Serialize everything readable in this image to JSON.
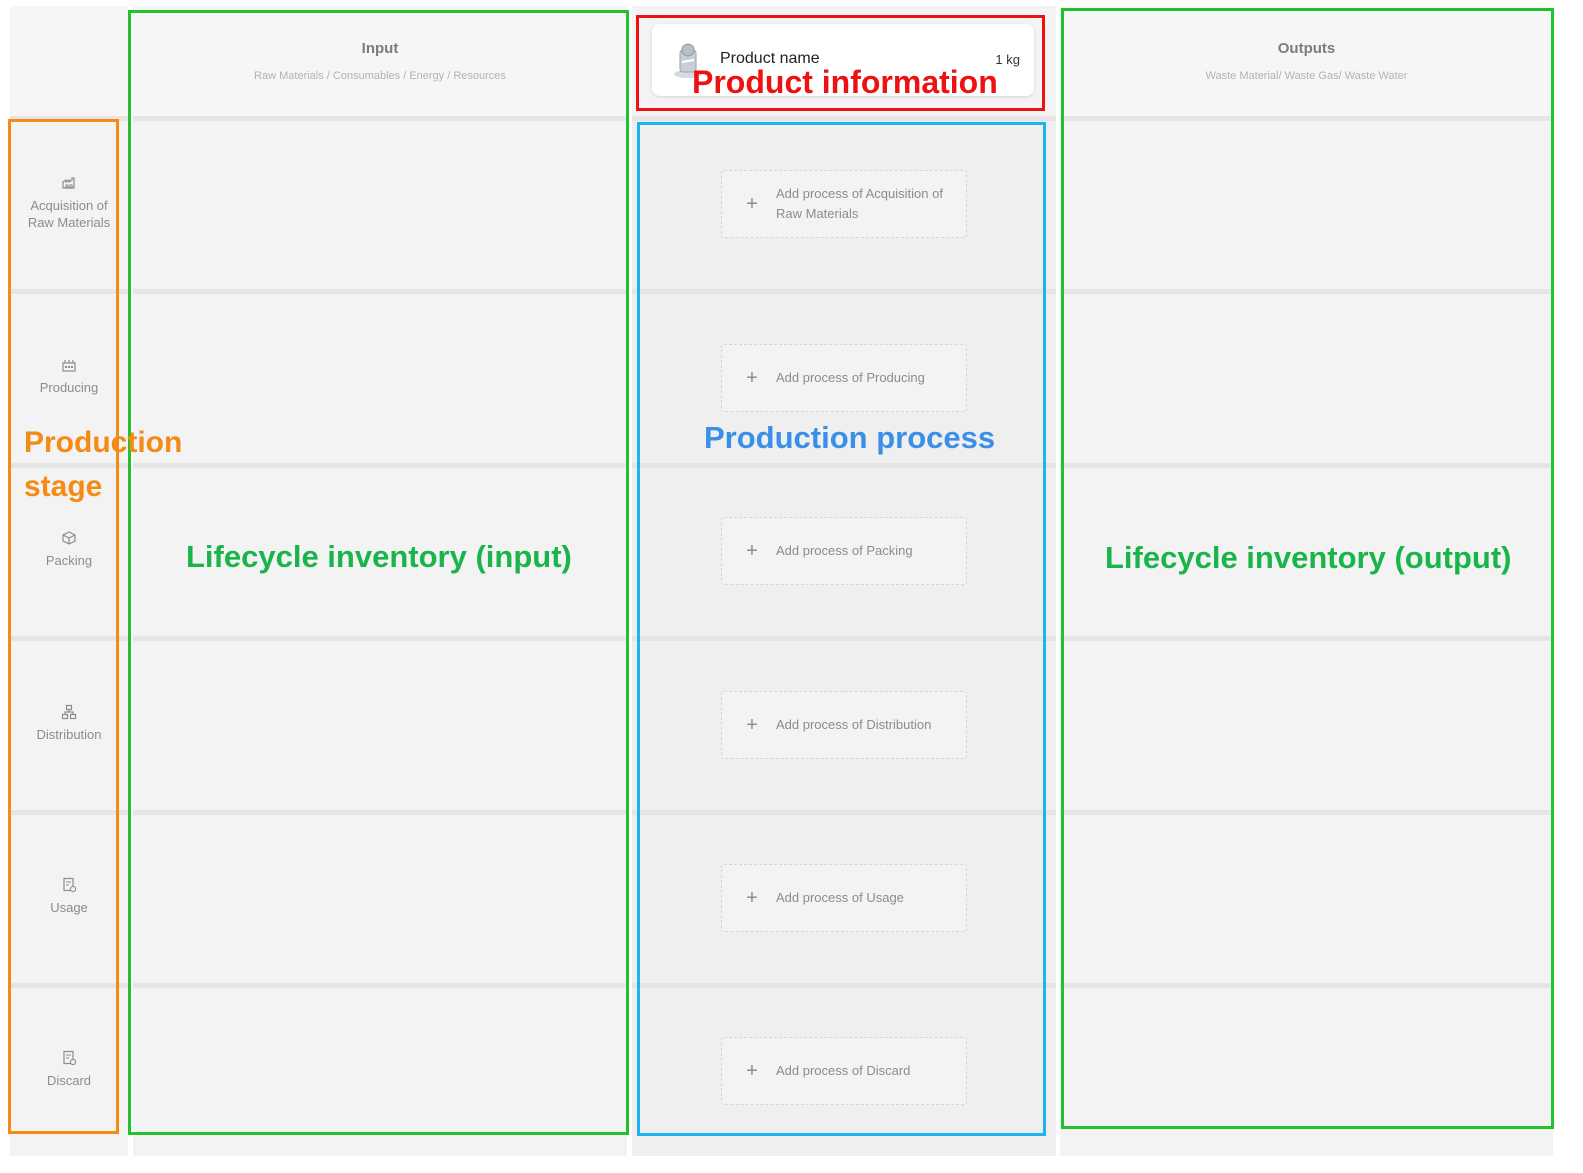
{
  "header": {
    "input_title": "Input",
    "input_subtitle": "Raw Materials / Consumables / Energy / Resources",
    "output_title": "Outputs",
    "output_subtitle": "Waste Material/ Waste Gas/ Waste Water"
  },
  "product": {
    "name": "Product name",
    "quantity": "1 kg"
  },
  "stages": [
    {
      "label_line1": "Acquisition of",
      "label_line2": "Raw Materials",
      "icon": "factory-icon"
    },
    {
      "label_line1": "Producing",
      "label_line2": "",
      "icon": "production-icon"
    },
    {
      "label_line1": "Packing",
      "label_line2": "",
      "icon": "package-icon"
    },
    {
      "label_line1": "Distribution",
      "label_line2": "",
      "icon": "network-icon"
    },
    {
      "label_line1": "Usage",
      "label_line2": "",
      "icon": "document-check-icon"
    },
    {
      "label_line1": "Discard",
      "label_line2": "",
      "icon": "document-check-icon"
    }
  ],
  "processes": [
    {
      "line1": "Add process of Acquisition of",
      "line2": "Raw Materials"
    },
    {
      "line1": "Add process of Producing",
      "line2": ""
    },
    {
      "line1": "Add process of Packing",
      "line2": ""
    },
    {
      "line1": "Add process of Distribution",
      "line2": ""
    },
    {
      "line1": "Add process of Usage",
      "line2": ""
    },
    {
      "line1": "Add process of Discard",
      "line2": ""
    }
  ],
  "annotations": {
    "product_information": "Product information",
    "production_process": "Production process",
    "production_stage_line1": "Production",
    "production_stage_line2": "stage",
    "lifecycle_input": "Lifecycle inventory (input)",
    "lifecycle_output": "Lifecycle inventory (output)"
  },
  "colors": {
    "annotation_red": "#ee1111",
    "annotation_blue": "#1fb4ef",
    "annotation_blue_text": "#3a8fe8",
    "annotation_green": "#22c12e",
    "annotation_green_text": "#1ab54a",
    "annotation_orange": "#f58a14"
  }
}
